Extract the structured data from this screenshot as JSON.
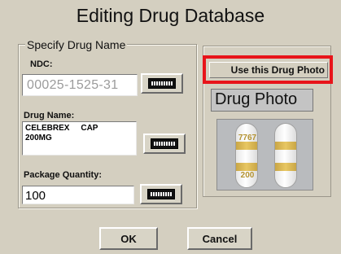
{
  "dialog": {
    "title": "Editing Drug Database"
  },
  "drug_name_group": {
    "legend": "Specify Drug Name",
    "ndc": {
      "label": "NDC:",
      "value": "00025-1525-31"
    },
    "drug_name": {
      "label": "Drug Name:",
      "value": "CELEBREX     CAP\n200MG"
    },
    "package_quantity": {
      "label": "Package Quantity:",
      "value": "100"
    },
    "keyboard_icon": "keyboard-icon"
  },
  "photo_panel": {
    "use_photo_label": "Use this Drug Photo",
    "photo_title": "Drug Photo",
    "capsule_print_top": "7767",
    "capsule_print_bottom": "200",
    "highlight_color": "#e8141a"
  },
  "footer": {
    "ok_label": "OK",
    "cancel_label": "Cancel"
  }
}
